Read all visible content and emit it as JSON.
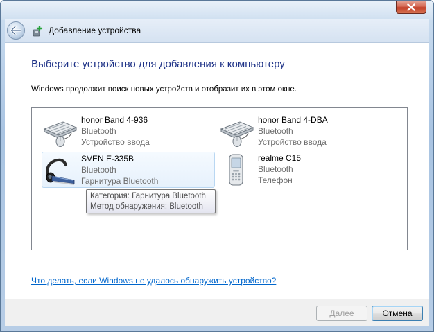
{
  "window": {
    "title": "Добавление устройства"
  },
  "main": {
    "heading": "Выберите устройство для добавления к компьютеру",
    "subtext": "Windows продолжит поиск новых устройств и отобразит их в этом окне.",
    "devices": [
      {
        "name": "honor Band 4-936",
        "line2": "Bluetooth",
        "line3": "Устройство ввода",
        "icon": "keyboard-mouse-icon"
      },
      {
        "name": "honor Band 4-DBA",
        "line2": "Bluetooth",
        "line3": "Устройство ввода",
        "icon": "keyboard-mouse-icon"
      },
      {
        "name": "SVEN E-335B",
        "line2": "Bluetooth",
        "line3": "Гарнитура Bluetooth",
        "icon": "bluetooth-headset-icon"
      },
      {
        "name": "realme C15",
        "line2": "Bluetooth",
        "line3": "Телефон",
        "icon": "phone-icon"
      }
    ],
    "tooltip": {
      "line1": "Категория: Гарнитура Bluetooth",
      "line2": "Метод обнаружения: Bluetooth"
    },
    "help_link": "Что делать, если Windows не удалось обнаружить устройство?"
  },
  "buttons": {
    "next_label": "Далее",
    "cancel_label": "Отмена"
  },
  "colors": {
    "heading": "#1e3287",
    "link": "#0066cc",
    "close_button": "#c2412a"
  }
}
